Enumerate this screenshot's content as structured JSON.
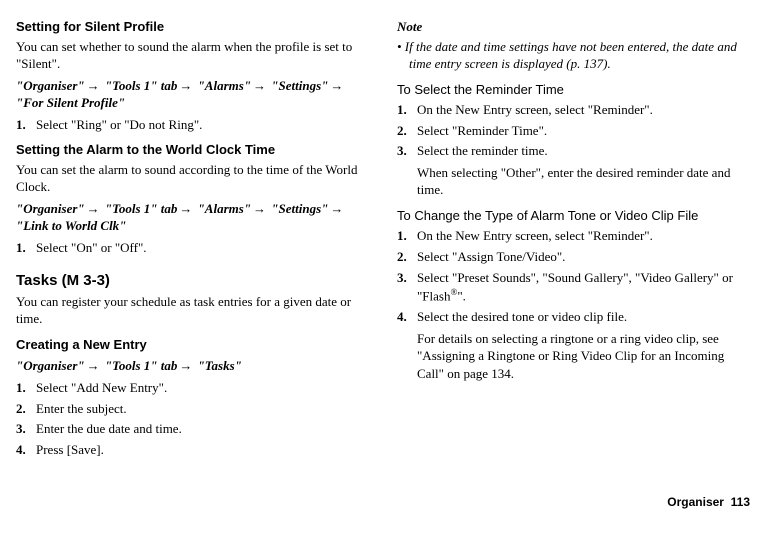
{
  "left": {
    "h1": "Setting for Silent Profile",
    "p1": "You can set whether to sound the alarm when the profile is set to \"Silent\".",
    "nav1_a": "\"Organiser\"",
    "nav1_b": "\"Tools 1\" tab",
    "nav1_c": "\"Alarms\"",
    "nav1_d": "\"Settings\"",
    "nav1_e": "\"For Silent Profile\"",
    "s1_1": "Select \"Ring\" or \"Do not Ring\".",
    "h2": "Setting the Alarm to the World Clock Time",
    "p2": "You can set the alarm to sound according to the time of the World Clock.",
    "nav2_a": "\"Organiser\"",
    "nav2_b": "\"Tools 1\" tab",
    "nav2_c": "\"Alarms\"",
    "nav2_d": "\"Settings\"",
    "nav2_e": "\"Link to World Clk\"",
    "s2_1": "Select \"On\" or \"Off\".",
    "h3": "Tasks (M 3-3)",
    "p3": "You can register your schedule as task entries for a given date or time.",
    "h4": "Creating a New Entry",
    "nav3_a": "\"Organiser\"",
    "nav3_b": "\"Tools 1\" tab",
    "nav3_c": "\"Tasks\"",
    "s3_1": "Select \"Add New Entry\".",
    "s3_2": "Enter the subject.",
    "s3_3": "Enter the due date and time.",
    "s3_4": "Press [Save]."
  },
  "right": {
    "note_t": "Note",
    "note_b": "• If the date and time settings have not been entered, the date and time entry screen is displayed (p. 137).",
    "h1": "To Select the Reminder Time",
    "s1_1": "On the New Entry screen, select \"Reminder\".",
    "s1_2": "Select \"Reminder Time\".",
    "s1_3": "Select the reminder time.",
    "s1_3b": "When selecting \"Other\", enter the desired reminder date and time.",
    "h2": "To Change the Type of Alarm Tone or Video Clip File",
    "s2_1": "On the New Entry screen, select \"Reminder\".",
    "s2_2": "Select \"Assign Tone/Video\".",
    "s2_3a": "Select \"Preset Sounds\", \"Sound Gallery\", \"Video Gallery\" or \"Flash",
    "s2_3b": "\".",
    "s2_4": "Select the desired tone or video clip file.",
    "s2_4b": "For details on selecting a ringtone or a ring video clip, see \"Assigning a Ringtone or Ring Video Clip for an Incoming Call\" on page 134."
  },
  "footer_label": "Organiser",
  "footer_page": "113"
}
